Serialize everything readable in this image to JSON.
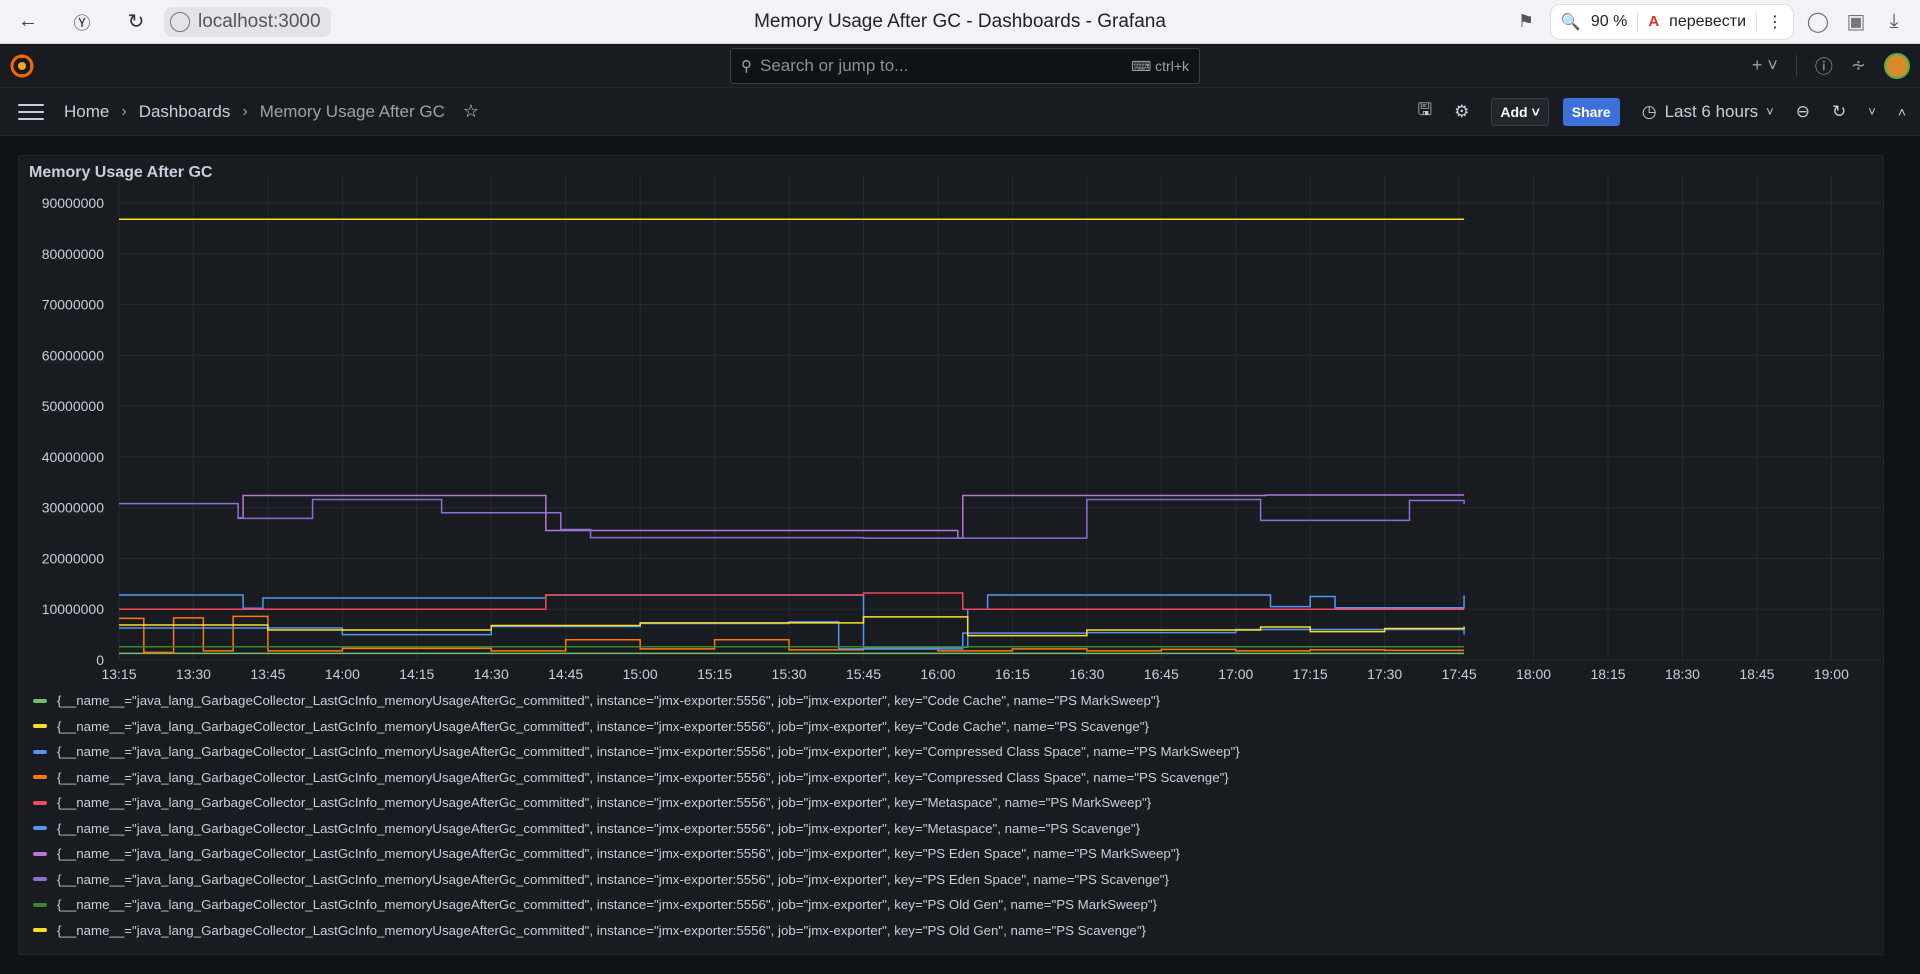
{
  "browser": {
    "url": "localhost:3000",
    "tab_title": "Memory Usage After GC - Dashboards - Grafana",
    "zoom": "90 %",
    "translate_label": "перевести"
  },
  "grafana": {
    "search_placeholder": "Search or jump to...",
    "search_shortcut": "ctrl+k",
    "breadcrumbs": [
      "Home",
      "Dashboards",
      "Memory Usage After GC"
    ],
    "add_label": "Add",
    "share_label": "Share",
    "time_range": "Last 6 hours"
  },
  "panel": {
    "title": "Memory Usage After GC"
  },
  "chart_data": {
    "type": "line",
    "title": "Memory Usage After GC",
    "ylim": [
      0,
      90000000
    ],
    "y_ticks": [
      "0",
      "10000000",
      "20000000",
      "30000000",
      "40000000",
      "50000000",
      "60000000",
      "70000000",
      "80000000",
      "90000000"
    ],
    "x_ticks": [
      "13:15",
      "13:30",
      "13:45",
      "14:00",
      "14:15",
      "14:30",
      "14:45",
      "15:00",
      "15:15",
      "15:30",
      "15:45",
      "16:00",
      "16:15",
      "16:30",
      "16:45",
      "17:00",
      "17:15",
      "17:30",
      "17:45",
      "18:00",
      "18:15",
      "18:30",
      "18:45",
      "19:00"
    ],
    "grid": true,
    "legend_placement": "bottom",
    "series": [
      {
        "name": "{__name__=\"java_lang_GarbageCollector_LastGcInfo_memoryUsageAfterGc_committed\", instance=\"jmx-exporter:5556\", job=\"jmx-exporter\", key=\"Code Cache\", name=\"PS MarkSweep\"}",
        "color": "#73bf69",
        "x": [
          "13:15",
          "17:46"
        ],
        "values": [
          1300000,
          1300000
        ]
      },
      {
        "name": "{__name__=\"java_lang_GarbageCollector_LastGcInfo_memoryUsageAfterGc_committed\", instance=\"jmx-exporter:5556\", job=\"jmx-exporter\", key=\"Code Cache\", name=\"PS Scavenge\"}",
        "color": "#fade2a",
        "x": [
          "13:15",
          "17:46"
        ],
        "values": [
          86800000,
          86800000
        ]
      },
      {
        "name": "{__name__=\"java_lang_GarbageCollector_LastGcInfo_memoryUsageAfterGc_committed\", instance=\"jmx-exporter:5556\", job=\"jmx-exporter\", key=\"Compressed Class Space\", name=\"PS MarkSweep\"}",
        "color": "#5794f2",
        "x": [
          "13:15",
          "13:39",
          "13:40",
          "13:44",
          "14:41",
          "15:40",
          "15:45",
          "15:50",
          "16:04",
          "16:06",
          "16:10",
          "17:05",
          "17:07",
          "17:15",
          "17:20",
          "17:46"
        ],
        "values": [
          12800000,
          12800000,
          10200000,
          12200000,
          12800000,
          12800000,
          2500000,
          2500000,
          2500000,
          10000000,
          12800000,
          12800000,
          10500000,
          12500000,
          10300000,
          12700000
        ]
      },
      {
        "name": "{__name__=\"java_lang_GarbageCollector_LastGcInfo_memoryUsageAfterGc_committed\", instance=\"jmx-exporter:5556\", job=\"jmx-exporter\", key=\"Compressed Class Space\", name=\"PS Scavenge\"}",
        "color": "#ff780a",
        "x": [
          "13:15",
          "13:20",
          "13:26",
          "13:32",
          "13:38",
          "13:45",
          "14:00",
          "14:30",
          "14:45",
          "15:00",
          "15:15",
          "15:30",
          "15:45",
          "16:00",
          "16:15",
          "16:30",
          "16:45",
          "17:00",
          "17:15",
          "17:30",
          "17:46"
        ],
        "values": [
          8200000,
          1500000,
          8300000,
          1800000,
          8600000,
          1800000,
          2300000,
          1800000,
          4000000,
          2200000,
          4000000,
          2000000,
          2200000,
          1800000,
          2200000,
          1800000,
          2100000,
          1800000,
          2000000,
          1900000,
          1900000
        ]
      },
      {
        "name": "{__name__=\"java_lang_GarbageCollector_LastGcInfo_memoryUsageAfterGc_committed\", instance=\"jmx-exporter:5556\", job=\"jmx-exporter\", key=\"Metaspace\", name=\"PS MarkSweep\"}",
        "color": "#f2495c",
        "x": [
          "13:15",
          "14:40",
          "14:41",
          "15:45",
          "16:04",
          "16:05",
          "17:46"
        ],
        "values": [
          10000000,
          10000000,
          12800000,
          13200000,
          13200000,
          10000000,
          10000000
        ]
      },
      {
        "name": "{__name__=\"java_lang_GarbageCollector_LastGcInfo_memoryUsageAfterGc_committed\", instance=\"jmx-exporter:5556\", job=\"jmx-exporter\", key=\"Metaspace\", name=\"PS Scavenge\"}",
        "color": "#5794f2",
        "x": [
          "13:15",
          "14:00",
          "14:30",
          "15:00",
          "15:30",
          "15:38",
          "15:40",
          "16:05",
          "16:30",
          "17:00",
          "17:46"
        ],
        "values": [
          6300000,
          5000000,
          6600000,
          7200000,
          7500000,
          7500000,
          2200000,
          5300000,
          5400000,
          6000000,
          5000000
        ]
      },
      {
        "name": "{__name__=\"java_lang_GarbageCollector_LastGcInfo_memoryUsageAfterGc_committed\", instance=\"jmx-exporter:5556\", job=\"jmx-exporter\", key=\"PS Eden Space\", name=\"PS MarkSweep\"}",
        "color": "#b877d9",
        "x": [
          "13:39",
          "13:40",
          "14:40",
          "14:41",
          "15:40",
          "16:04",
          "16:05",
          "17:05",
          "17:06",
          "17:46"
        ],
        "values": [
          28000000,
          32400000,
          32400000,
          25500000,
          25500000,
          24000000,
          32400000,
          32400000,
          32500000,
          32500000
        ]
      },
      {
        "name": "{__name__=\"java_lang_GarbageCollector_LastGcInfo_memoryUsageAfterGc_committed\", instance=\"jmx-exporter:5556\", job=\"jmx-exporter\", key=\"PS Eden Space\", name=\"PS Scavenge\"}",
        "color": "#8f6ed4",
        "x": [
          "13:15",
          "13:39",
          "13:54",
          "14:20",
          "14:44",
          "14:50",
          "15:45",
          "16:04",
          "16:30",
          "17:05",
          "17:35",
          "17:46"
        ],
        "values": [
          30800000,
          27900000,
          31600000,
          29000000,
          25700000,
          24100000,
          24000000,
          24000000,
          31600000,
          27500000,
          31400000,
          30700000
        ]
      },
      {
        "name": "{__name__=\"java_lang_GarbageCollector_LastGcInfo_memoryUsageAfterGc_committed\", instance=\"jmx-exporter:5556\", job=\"jmx-exporter\", key=\"PS Old Gen\", name=\"PS MarkSweep\"}",
        "color": "#37872d",
        "x": [
          "13:15",
          "17:46"
        ],
        "values": [
          2600000,
          2600000
        ]
      },
      {
        "name": "{__name__=\"java_lang_GarbageCollector_LastGcInfo_memoryUsageAfterGc_committed\", instance=\"jmx-exporter:5556\", job=\"jmx-exporter\", key=\"PS Old Gen\", name=\"PS Scavenge\"}",
        "color": "#fade2a",
        "x": [
          "13:15",
          "13:40",
          "13:45",
          "14:30",
          "15:00",
          "15:45",
          "16:04",
          "16:06",
          "16:30",
          "17:05",
          "17:15",
          "17:30",
          "17:46"
        ],
        "values": [
          6900000,
          6900000,
          5900000,
          6800000,
          7300000,
          8500000,
          8500000,
          4800000,
          5900000,
          6500000,
          5600000,
          6200000,
          6600000
        ]
      }
    ]
  }
}
